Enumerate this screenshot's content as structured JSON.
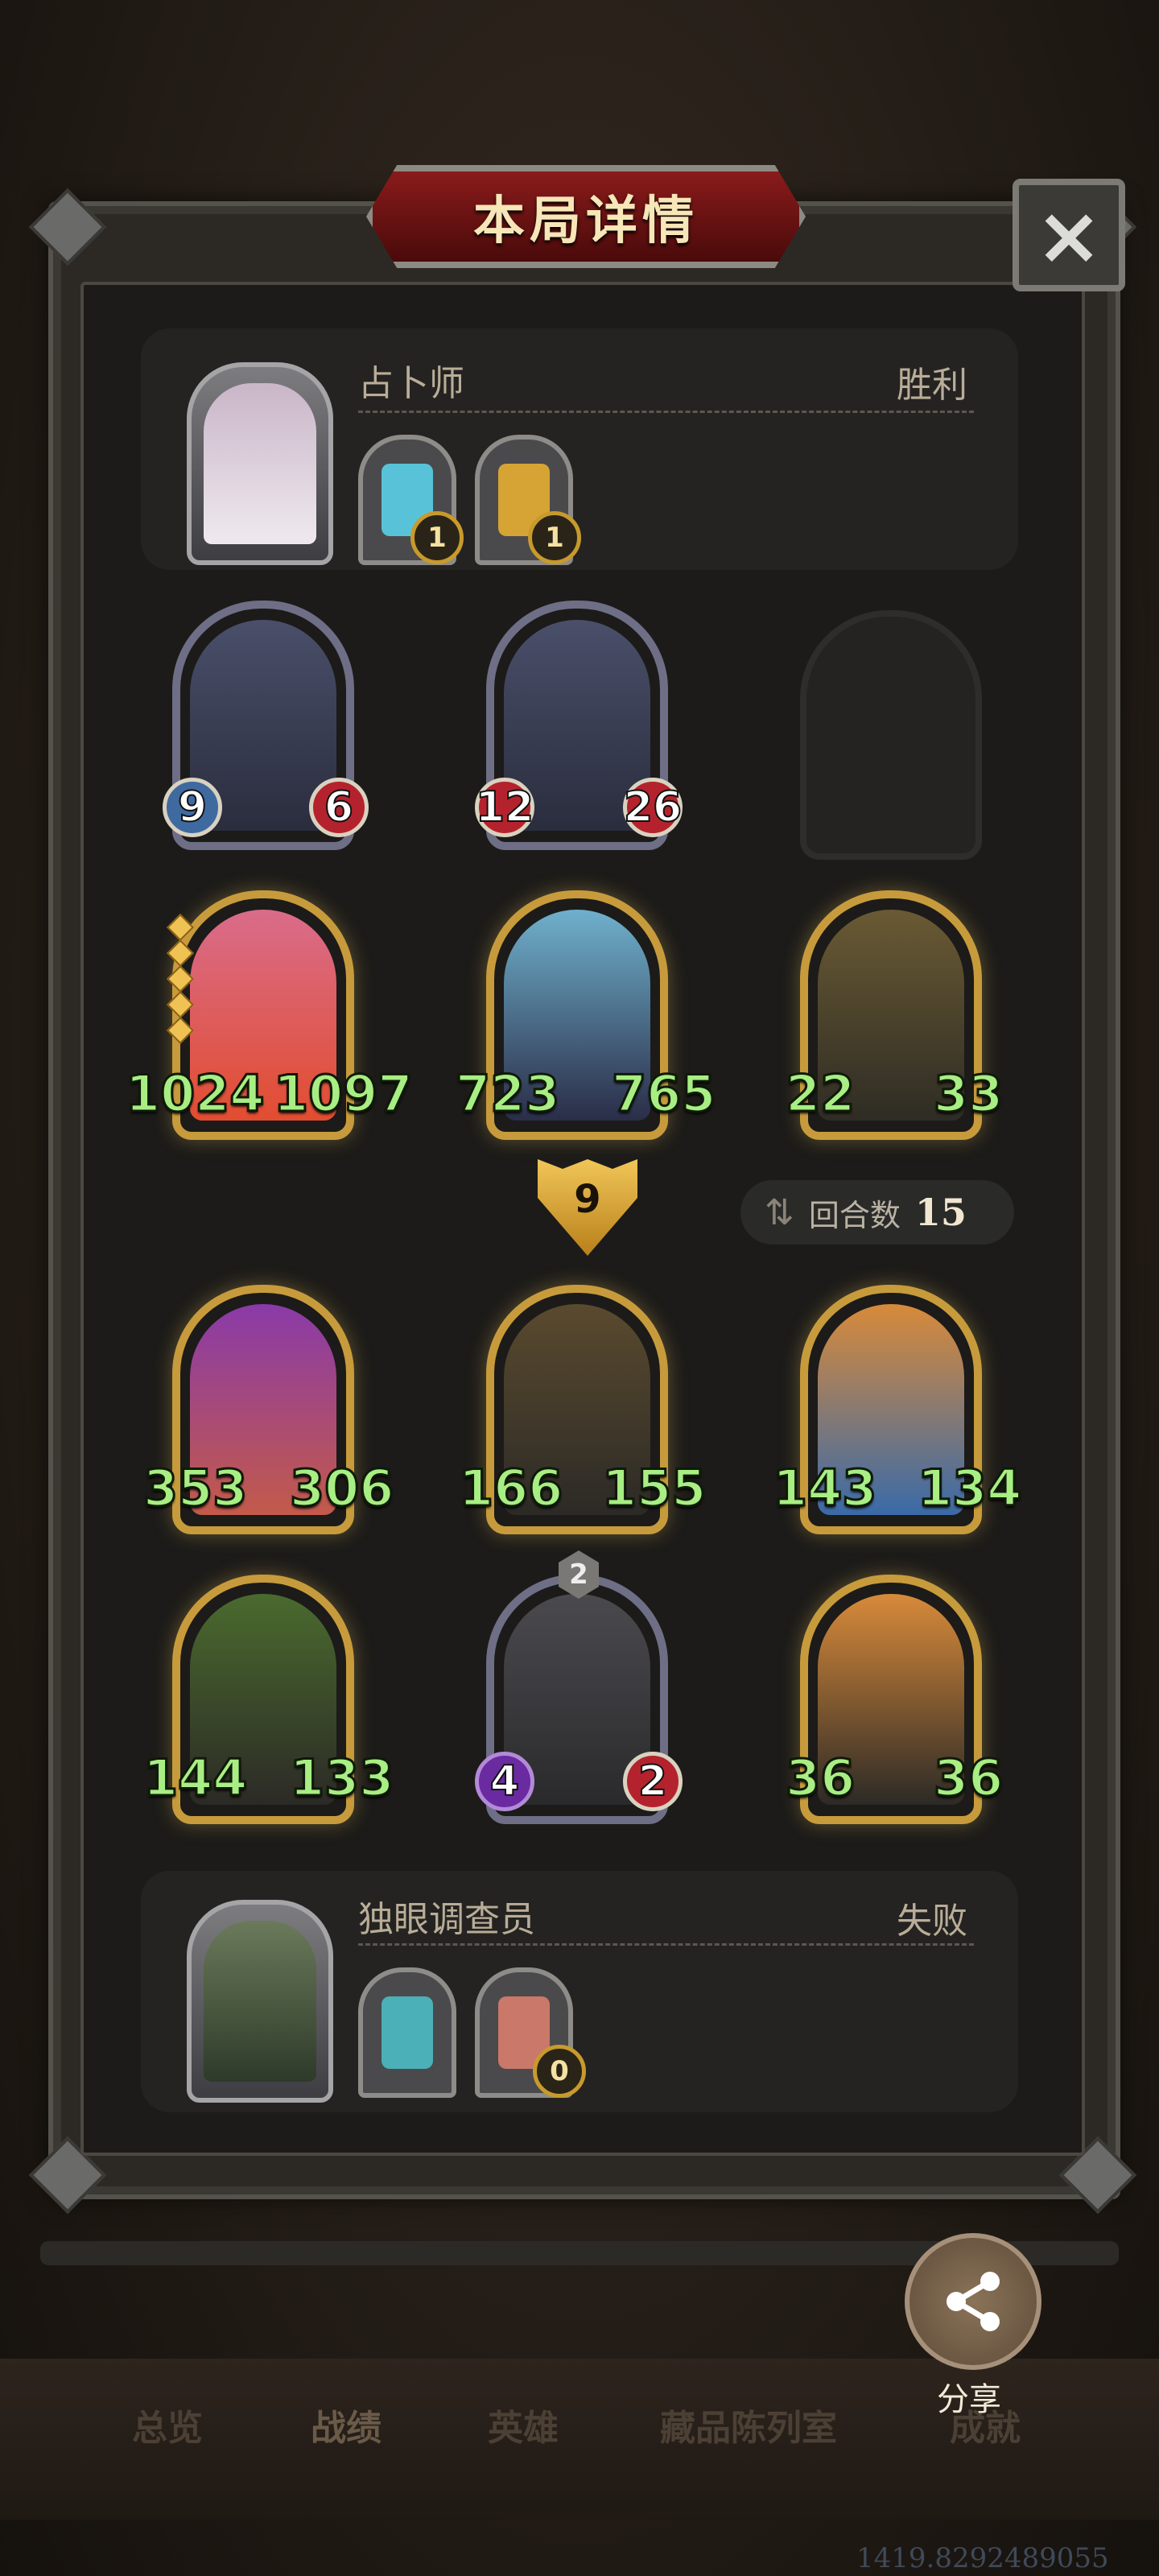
{
  "title": "本局详情",
  "close_icon": "×",
  "top_player": {
    "name": "占卜师",
    "result": "胜利",
    "relics": [
      {
        "icon": "crystal-card-icon",
        "count": "1",
        "color": "#58c3d8"
      },
      {
        "icon": "gold-mask-icon",
        "count": "1",
        "color": "#d6a434"
      }
    ]
  },
  "top_board": [
    {
      "attack": "9",
      "health": "6",
      "frame": "silver"
    },
    {
      "attack": "12",
      "health": "26",
      "frame": "silver"
    },
    {
      "empty": true
    }
  ],
  "top_board_row2": [
    {
      "attack": "1024",
      "health": "1097",
      "frame": "gold",
      "stars": 5
    },
    {
      "attack": "723",
      "health": "765",
      "frame": "gold"
    },
    {
      "attack": "22",
      "health": "33",
      "frame": "gold"
    }
  ],
  "tier": "9",
  "turns": {
    "label": "回合数",
    "count": "15"
  },
  "bottom_board_row1": [
    {
      "attack": "353",
      "health": "306",
      "frame": "gold"
    },
    {
      "attack": "166",
      "health": "155",
      "frame": "gold"
    },
    {
      "attack": "143",
      "health": "134",
      "frame": "gold"
    }
  ],
  "bottom_board_row2": [
    {
      "attack": "144",
      "health": "133",
      "frame": "gold"
    },
    {
      "attack": "4",
      "health": "2",
      "frame": "silver",
      "level": "2"
    },
    {
      "attack": "36",
      "health": "36",
      "frame": "gold"
    }
  ],
  "bottom_player": {
    "name": "独眼调查员",
    "result": "失败",
    "relics": [
      {
        "icon": "blade-icon",
        "count": "",
        "color": "#4bb0b8"
      },
      {
        "icon": "fist-icon",
        "count": "0",
        "color": "#c9786a"
      }
    ]
  },
  "share": {
    "label": "分享",
    "icon": "share-icon"
  },
  "nav": [
    "总览",
    "战绩",
    "英雄",
    "藏品陈列室",
    "成就"
  ],
  "coords": "1419.8292489055"
}
